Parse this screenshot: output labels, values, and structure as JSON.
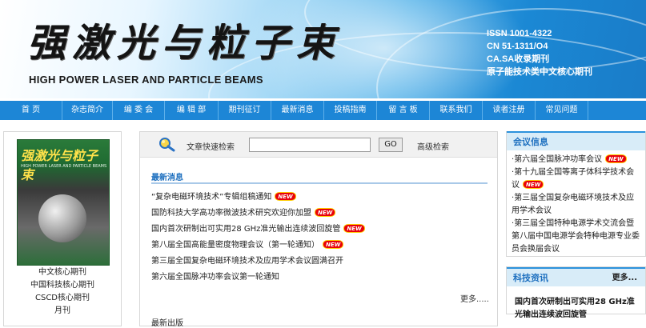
{
  "header": {
    "cn_title": "强激光与粒子束",
    "en_title": "HIGH POWER LASER AND PARTICLE BEAMS",
    "issn": "ISSN 1001-4322",
    "cn": "CN 51-1311/O4",
    "indexing": "CA.SA收录期刊",
    "core": "原子能技术类中文核心期刊"
  },
  "nav": {
    "items": [
      "首 页",
      "杂志简介",
      "编 委 会",
      "编 辑 部",
      "期刊征订",
      "最新消息",
      "投稿指南",
      "留 言 板",
      "联系我们",
      "读者注册",
      "常见问题"
    ]
  },
  "cover": {
    "title": "强激光与粒子束",
    "subtitle": "HIGH POWER LASER AND PARTICLE BEAMS"
  },
  "left": {
    "lines": [
      "中文核心期刊",
      "中国科技核心期刊",
      "CSCD核心期刊",
      "月刊"
    ]
  },
  "search": {
    "label": "文章快速检索",
    "value": "",
    "go": "GO",
    "advanced": "高级检索"
  },
  "news": {
    "heading": "最新消息",
    "badge": "NEW",
    "items": [
      {
        "text": "“复杂电磁环境技术”专辑组稿通知",
        "is_new": true
      },
      {
        "text": "国防科技大学高功率微波技术研究欢迎你加盟",
        "is_new": true
      },
      {
        "text": "国内首次研制出可实用28 GHz准光输出连续波回旋管",
        "is_new": true
      },
      {
        "text": "第八届全国高能量密度物理会议（第一轮通知）",
        "is_new": true
      },
      {
        "text": "第三届全国复杂电磁环境技术及应用学术会议圆满召开",
        "is_new": false
      },
      {
        "text": "第六届全国脉冲功率会议第一轮通知",
        "is_new": false
      }
    ],
    "more": "更多.....",
    "latest_pub": "最新出版"
  },
  "meetings": {
    "heading": "会议信息",
    "items": [
      "第六届全国脉冲功率会议",
      "第十九届全国等离子体科学技术会议",
      "第三届全国复杂电磁环境技术及应用学术会议",
      "第三届全国特种电源学术交流会暨第八届中国电源学会特种电源专业委员会换届会议"
    ]
  },
  "sci_news": {
    "heading": "科技资讯",
    "more": "更多...",
    "item": "国内首次研制出可实用28 GHz准光输出连续波回旋管"
  },
  "colors": {
    "nav": "#1d86d6",
    "accent": "#1d6fbf",
    "badge": "#e8000a"
  }
}
